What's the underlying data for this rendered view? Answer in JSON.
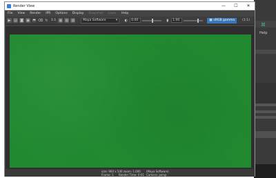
{
  "background_app": {
    "help_label": "Help"
  },
  "window": {
    "title": "Render View",
    "controls": {
      "minimize": "—",
      "maximize": "☐",
      "close": "✕"
    }
  },
  "menu": {
    "items": [
      "File",
      "View",
      "Render",
      "IPR",
      "Options",
      "Display",
      "Snapshot",
      "Layer",
      "Help"
    ]
  },
  "toolbar": {
    "render_ratio": "1:1",
    "renderer": "Maya Software",
    "exposure": "0.00",
    "gamma": "1.00",
    "color_mgmt": "sRGB gamma",
    "ratio_text": "(1:1)",
    "exposure_level": 0.5,
    "gamma_level": 0.7
  },
  "image": {
    "dominant_color": "#1e8a2e"
  },
  "status": {
    "size": "size: 960 x 540  zoom: 1.000",
    "renderer": "(Maya Software)",
    "frame": "Frame: 1",
    "render_time": "Render Time: 0:01",
    "camera": "Camera: persp"
  },
  "colors": {
    "window_bg": "#444444",
    "accent": "#3a78b5",
    "render_green": "#1e8a2e"
  }
}
